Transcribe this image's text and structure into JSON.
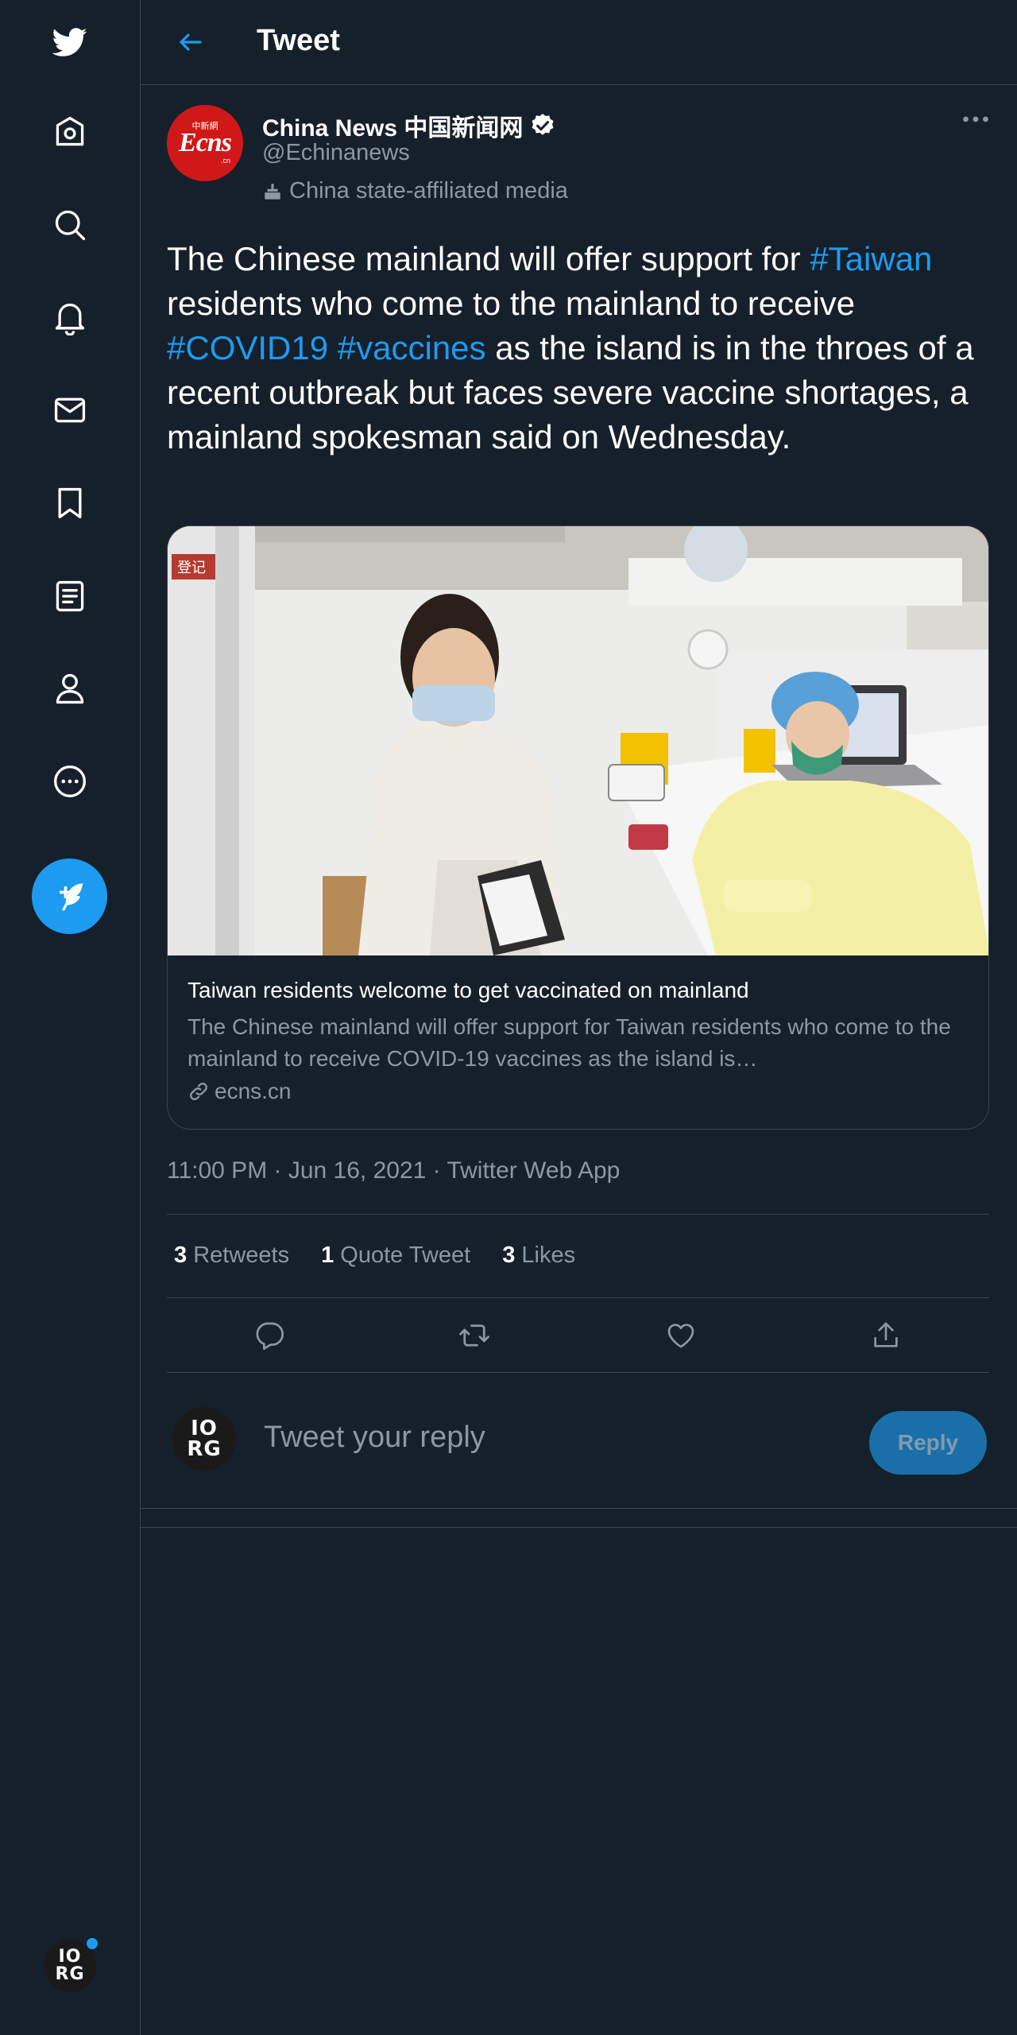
{
  "header": {
    "title": "Tweet"
  },
  "sidebar": {
    "items": [
      {
        "icon": "twitter-logo-icon"
      },
      {
        "icon": "home-icon"
      },
      {
        "icon": "explore-search-icon"
      },
      {
        "icon": "notifications-bell-icon"
      },
      {
        "icon": "messages-mail-icon"
      },
      {
        "icon": "bookmarks-icon"
      },
      {
        "icon": "lists-icon"
      },
      {
        "icon": "profile-icon"
      },
      {
        "icon": "more-icon"
      }
    ],
    "compose_icon": "compose-tweet-icon",
    "account_avatar": {
      "line1": "IO",
      "line2": "RG"
    }
  },
  "tweet": {
    "author_name": "China News 中国新闻网",
    "author_handle": "@Echinanews",
    "affiliation": "China state-affiliated media",
    "avatar_logo": {
      "small": "中新網",
      "main": "Ecns",
      "suffix": ".cn"
    },
    "text_parts": {
      "t1": "The Chinese mainland will offer support for ",
      "h1": "#Taiwan",
      "t2": " residents who come to the mainland to receive ",
      "h2": "#COVID19",
      "t3": " ",
      "h3": "#vaccines",
      "t4": " as the island is in the throes of a recent outbreak but faces severe vaccine shortages, a mainland spokesman said on Wednesday."
    },
    "card": {
      "title": "Taiwan residents welcome to get vaccinated on mainland",
      "description": "The Chinese mainland will offer support for Taiwan residents who come to the mainland to receive COVID-19 vaccines as the island is…",
      "domain": "ecns.cn",
      "image_sign": "登记"
    },
    "timestamp": "11:00 PM · Jun 16, 2021 · Twitter Web App",
    "stats": {
      "retweets_count": "3",
      "retweets_label": "Retweets",
      "quotes_count": "1",
      "quotes_label": "Quote Tweet",
      "likes_count": "3",
      "likes_label": "Likes"
    },
    "actions": [
      "reply-icon",
      "retweet-icon",
      "like-heart-icon",
      "share-icon"
    ]
  },
  "reply_box": {
    "placeholder": "Tweet your reply",
    "button_label": "Reply",
    "avatar": {
      "line1": "IO",
      "line2": "RG"
    }
  },
  "colors": {
    "background": "#15202b",
    "accent": "#1d9bf0",
    "secondary_text": "#8b98a5",
    "border": "#38444d"
  }
}
